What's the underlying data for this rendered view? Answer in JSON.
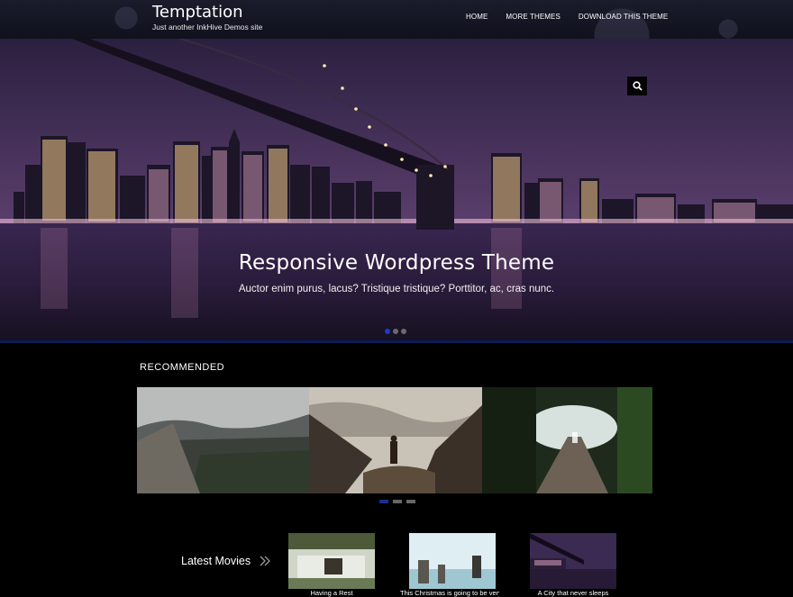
{
  "header": {
    "site_title": "Temptation",
    "tagline": "Just another InkHive Demos site",
    "nav": [
      "HOME",
      "MORE THEMES",
      "DOWNLOAD THIS THEME"
    ]
  },
  "hero": {
    "heading": "Responsive Wordpress Theme",
    "subtitle": "Auctor enim purus, lacus? Tristique tristique? Porttitor, ac, cras nunc.",
    "slide_count": 3,
    "active_slide": 1
  },
  "recommended": {
    "title": "RECOMMENDED",
    "images": [
      "misty-valley",
      "hiker-canyon",
      "forest-boardwalk"
    ],
    "page_count": 3,
    "active_page": 1
  },
  "latest_movies": {
    "label": "Latest Movies",
    "items": [
      {
        "caption": "Having a Rest"
      },
      {
        "caption": "This Christmas is going to be very"
      },
      {
        "caption": "A City that never sleeps"
      }
    ]
  },
  "colors": {
    "accent": "#1f3cc8",
    "header_bg": "#151726",
    "page_bg": "#000000"
  }
}
